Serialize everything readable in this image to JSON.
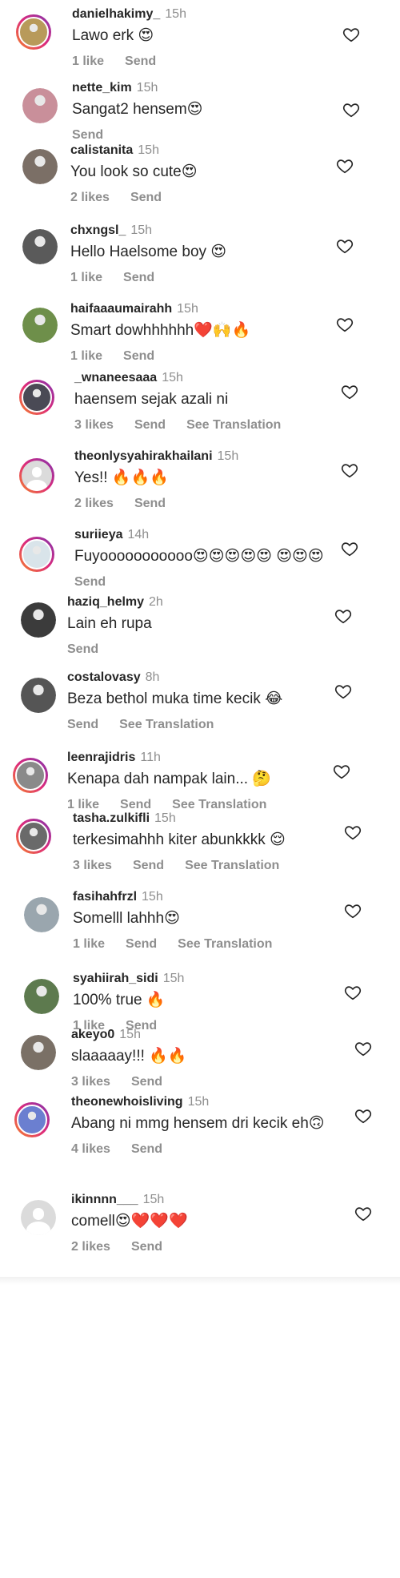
{
  "comments": [
    {
      "username": "danielhakimy_",
      "time": "15h",
      "text": "Lawo erk 😍",
      "likes": "1 like",
      "reply": "Send",
      "translation": "",
      "ring": true,
      "avatar_color": "#b89a5a"
    },
    {
      "username": "nette_kim",
      "time": "15h",
      "text": "Sangat2 hensem😍",
      "likes": "",
      "reply": "Send",
      "translation": "",
      "ring": false,
      "avatar_color": "#c98f9a"
    },
    {
      "username": "calistanita",
      "time": "15h",
      "text": "You look so cute😍",
      "likes": "2 likes",
      "reply": "Send",
      "translation": "",
      "ring": false,
      "avatar_color": "#7b6f66"
    },
    {
      "username": "chxngsl_",
      "time": "15h",
      "text": "Hello Haelsome boy 😍",
      "likes": "1 like",
      "reply": "Send",
      "translation": "",
      "ring": false,
      "avatar_color": "#5a5a5a"
    },
    {
      "username": "haifaaaumairahh",
      "time": "15h",
      "text": "Smart dowhhhhhh❤️🙌🔥",
      "likes": "1 like",
      "reply": "Send",
      "translation": "",
      "ring": false,
      "avatar_color": "#6e8f4a"
    },
    {
      "username": "_wnaneesaaa",
      "time": "15h",
      "text": "haensem sejak azali ni",
      "likes": "3 likes",
      "reply": "Send",
      "translation": "See Translation",
      "ring": true,
      "avatar_color": "#4a4a55"
    },
    {
      "username": "theonlysyahirakhailani",
      "time": "15h",
      "text": "Yes!! 🔥🔥🔥",
      "likes": "2 likes",
      "reply": "Send",
      "translation": "",
      "ring": true,
      "avatar_color": "placeholder"
    },
    {
      "username": "suriieya",
      "time": "14h",
      "text": "Fuyooooooooooo😍😍😍😍😍 😍😍😍",
      "likes": "",
      "reply": "Send",
      "translation": "",
      "ring": true,
      "avatar_color": "#d9e4ea"
    },
    {
      "username": "haziq_helmy",
      "time": "2h",
      "text": "Lain eh rupa",
      "likes": "",
      "reply": "Send",
      "translation": "",
      "ring": false,
      "avatar_color": "#3b3b3b"
    },
    {
      "username": "costalovasy",
      "time": "8h",
      "text": "Beza bethol muka time kecik 😂",
      "likes": "",
      "reply": "Send",
      "translation": "See Translation",
      "ring": false,
      "avatar_color": "#555555"
    },
    {
      "username": "leenrajidris",
      "time": "11h",
      "text": "Kenapa dah nampak lain... 🤔",
      "likes": "1 like",
      "reply": "Send",
      "translation": "See Translation",
      "ring": true,
      "avatar_color": "#8a8a8a"
    },
    {
      "username": "tasha.zulkifli",
      "time": "15h",
      "text": "terkesimahhh kiter abunkkkk 😌",
      "likes": "3 likes",
      "reply": "Send",
      "translation": "See Translation",
      "ring": true,
      "avatar_color": "#6a6a6a"
    },
    {
      "username": "fasihahfrzl",
      "time": "15h",
      "text": "Somelll lahhh😍",
      "likes": "1 like",
      "reply": "Send",
      "translation": "See Translation",
      "ring": false,
      "avatar_color": "#9aa6ae"
    },
    {
      "username": "syahiirah_sidi",
      "time": "15h",
      "text": "100% true 🔥",
      "likes": "1 like",
      "reply": "Send",
      "translation": "",
      "ring": false,
      "avatar_color": "#5d7a4e"
    },
    {
      "username": "akeyo0",
      "time": "15h",
      "text": "slaaaaay!!! 🔥🔥",
      "likes": "3 likes",
      "reply": "Send",
      "translation": "",
      "ring": false,
      "avatar_color": "#7a7066"
    },
    {
      "username": "theonewhoisliving",
      "time": "15h",
      "text": "Abang ni mmg hensem dri kecik eh🙃",
      "likes": "4 likes",
      "reply": "Send",
      "translation": "",
      "ring": true,
      "avatar_color": "#6b7fd0"
    },
    {
      "username": "ikinnnn___",
      "time": "15h",
      "text": "comell😍❤️❤️❤️",
      "likes": "2 likes",
      "reply": "Send",
      "translation": "",
      "ring": false,
      "avatar_color": "placeholder"
    }
  ],
  "colors": {
    "ring_start": "#f58529",
    "ring_mid": "#dd2a7b",
    "ring_end": "#8134af",
    "muted": "#8e8e8e",
    "text": "#262626"
  },
  "icons": {
    "like": "heart-outline-icon"
  }
}
